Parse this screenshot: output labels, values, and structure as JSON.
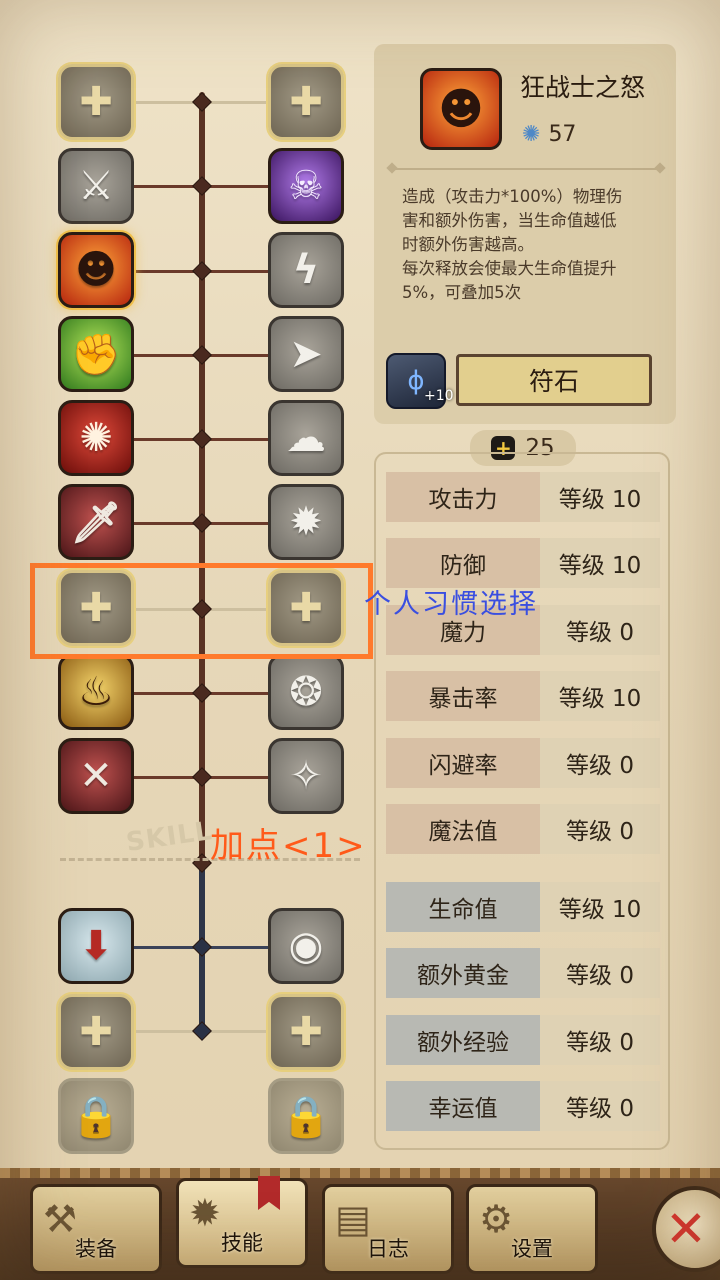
{
  "skill_detail": {
    "name": "狂战士之怒",
    "gem_count": "57",
    "desc_line1": "造成（攻击力*100%）物理伤",
    "desc_line2": "害和额外伤害，当生命值越低",
    "desc_line3": "时额外伤害越高。",
    "desc_line4": "每次释放会使最大生命值提升",
    "desc_line5": "5%，可叠加5次"
  },
  "rune": {
    "plus": "+10",
    "button_label": "符石"
  },
  "points": {
    "available": "25"
  },
  "stats": [
    {
      "name": "攻击力",
      "level": "等级 10"
    },
    {
      "name": "防御",
      "level": "等级 10"
    },
    {
      "name": "魔力",
      "level": "等级 0"
    },
    {
      "name": "暴击率",
      "level": "等级 10"
    },
    {
      "name": "闪避率",
      "level": "等级 0"
    },
    {
      "name": "魔法值",
      "level": "等级 0"
    },
    {
      "name": "生命值",
      "level": "等级 10"
    },
    {
      "name": "额外黄金",
      "level": "等级 0"
    },
    {
      "name": "额外经验",
      "level": "等级 0"
    },
    {
      "name": "幸运值",
      "level": "等级 0"
    }
  ],
  "tree": {
    "skill_label": "SKILL"
  },
  "annotations": {
    "blue_note": "个人习惯选择",
    "orange_note": "加点<1>"
  },
  "tabs": [
    {
      "label": "装备",
      "icon": "axe-icon"
    },
    {
      "label": "技能",
      "icon": "skill-sun-icon"
    },
    {
      "label": "日志",
      "icon": "journal-icon"
    },
    {
      "label": "设置",
      "icon": "gear-icon"
    }
  ],
  "colors": {
    "accent_orange": "#ff7a2c",
    "note_blue": "#3a4fe0",
    "close_red": "#d2332c"
  }
}
